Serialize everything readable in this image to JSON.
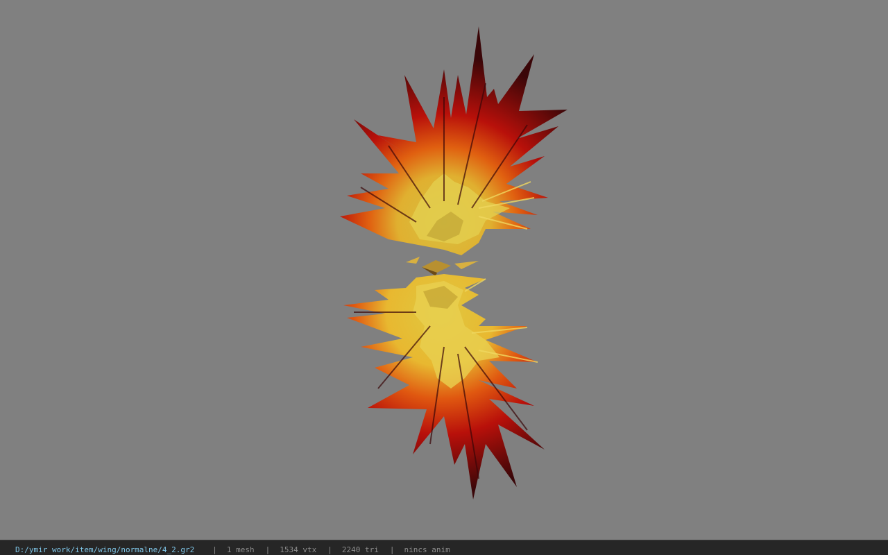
{
  "viewport": {
    "background_color": "#808080",
    "model": "wing"
  },
  "status_bar": {
    "file_path": "D:/ymir work/item/wing/normalne/4_2.gr2",
    "separator": "|",
    "mesh_count": "1 mesh",
    "vertex_count": "1534 vtx",
    "triangle_count": "2240 tri",
    "animation": "nincs anim"
  },
  "colors": {
    "path_text": "#7fc6e8",
    "status_text": "#8c8c8c",
    "status_bg": "#262626",
    "wing_dark": "#4a0a0c",
    "wing_red": "#c0160a",
    "wing_orange": "#e85a10",
    "wing_yellow": "#e8c840"
  }
}
